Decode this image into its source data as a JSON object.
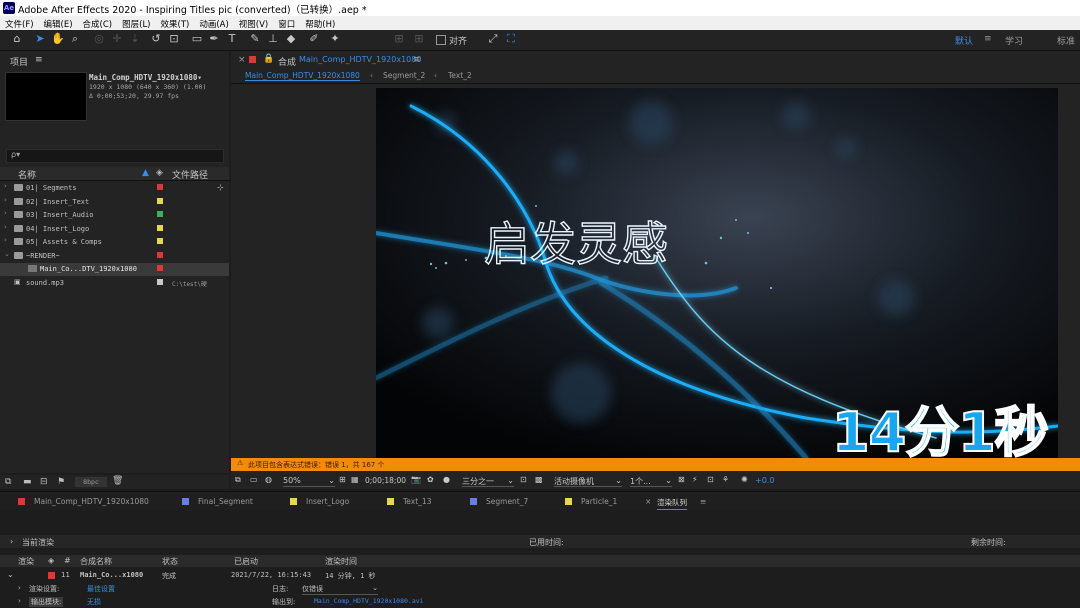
{
  "app": {
    "logo": "Ae",
    "title": "Adobe After Effects 2020 - Inspiring Titles pic (converted)（已转换）.aep *"
  },
  "menu": [
    "文件(F)",
    "编辑(E)",
    "合成(C)",
    "图层(L)",
    "效果(T)",
    "动画(A)",
    "视图(V)",
    "窗口",
    "帮助(H)"
  ],
  "toolbar": {
    "align_label": "对齐",
    "workspaces": [
      "默认",
      "学习",
      "标准"
    ],
    "menu_glyph": "≡"
  },
  "project": {
    "title": "项目",
    "menu_glyph": "≡",
    "selected_name": "Main_Comp_HDTV_1920x1080▾",
    "selected_info_1": "1920 x 1080 (640 x 360) (1.00)",
    "selected_info_2": "Δ 0;00;53;20, 29.97 fps",
    "search_placeholder": "ρ▾",
    "col_name": "名称",
    "col_path": "文件路径",
    "items": [
      {
        "name": "01| Segments",
        "color": "#d83a3a"
      },
      {
        "name": "02| Insert_Text",
        "color": "#e6d84a"
      },
      {
        "name": "03| Insert_Audio",
        "color": "#3fb04f"
      },
      {
        "name": "04| Insert_Logo",
        "color": "#e6d84a"
      },
      {
        "name": "05| Assets & Comps",
        "color": "#e6d84a"
      },
      {
        "name": "~RENDER~",
        "color": "#d83a3a"
      },
      {
        "name": "Main_Co...DTV_1920x1080",
        "color": "#d83a3a"
      },
      {
        "name": "sound.mp3",
        "color": "#c8c8c8",
        "path": "C:\\test\\硬"
      }
    ],
    "bpc": "8bpc"
  },
  "comp": {
    "panel_label": "合成",
    "name": "Main_Comp_HDTV_1920x1080",
    "breadcrumbs": [
      "Main_Comp_HDTV_1920x1080",
      "Segment_2",
      "Text_2"
    ],
    "title_text": "启发灵感",
    "timer": "14分1秒",
    "warning": "此项目包含表达式错误：错误 1，共 167 个",
    "zoom": "50%",
    "timecode": "0;00;18;00",
    "resolution": "三分之一",
    "camera": "活动摄像机",
    "views": "1个...",
    "exposure": "+0.0"
  },
  "timeline_tabs": [
    {
      "name": "Main_Comp_HDTV_1920x1080",
      "color": "#d83a3a"
    },
    {
      "name": "Final_Segment",
      "color": "#6b7de0"
    },
    {
      "name": "Insert_Logo",
      "color": "#e6d84a"
    },
    {
      "name": "Text_13",
      "color": "#e6d84a"
    },
    {
      "name": "Segment_7",
      "color": "#6b7de0"
    },
    {
      "name": "Particle_1",
      "color": "#e6d84a"
    },
    {
      "name": "渲染队列",
      "color": ""
    }
  ],
  "render_queue": {
    "current_render": "当前渲染",
    "elapsed_label": "已用时间:",
    "remaining_label": "剩余时间:",
    "columns": [
      "渲染",
      "#",
      "合成名称",
      "状态",
      "已启动",
      "渲染时间"
    ],
    "item": {
      "index": "11",
      "comp": "Main_Co...x1080",
      "status": "完成",
      "started": "2021/7/22, 16:15:43",
      "render_time": "14 分钟, 1 秒"
    },
    "settings_label": "渲染设置:",
    "settings_value": "最佳设置",
    "log_label": "日志:",
    "log_value": "仅错误",
    "output_module_label": "输出模块:",
    "output_module_value": "无损",
    "output_to_label": "输出到:",
    "output_to_value": "Main_Comp_HDTV_1920x1080.avi"
  }
}
